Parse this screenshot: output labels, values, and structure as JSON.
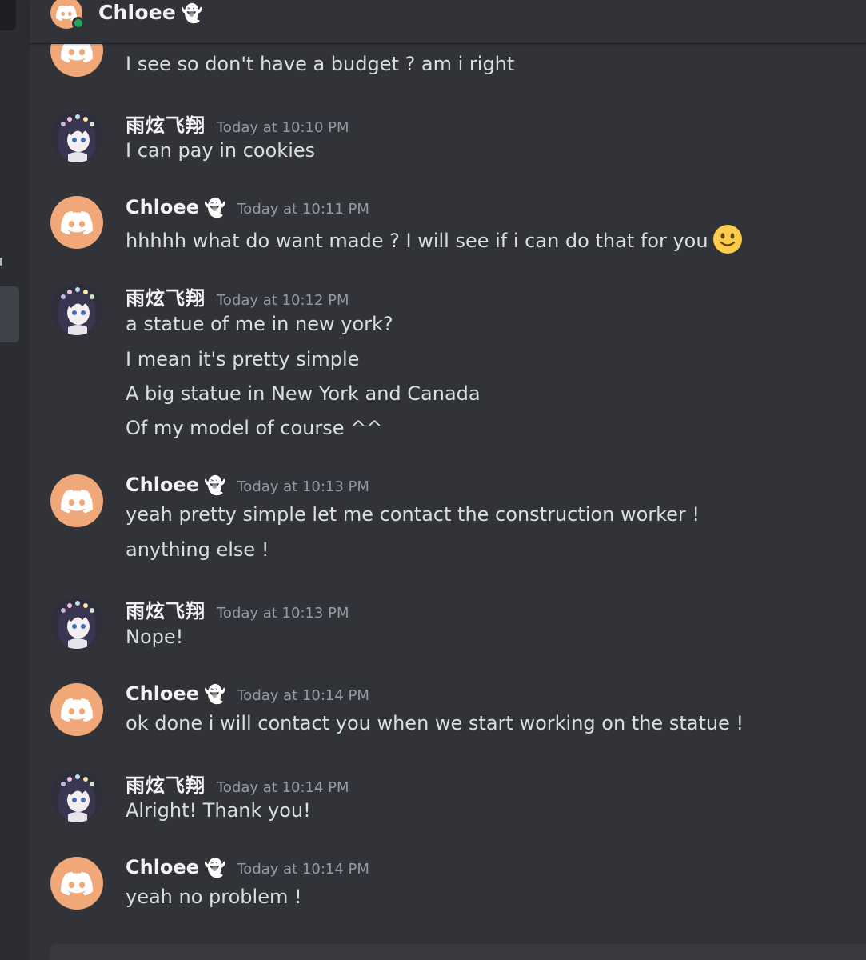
{
  "header": {
    "title": "Chloee"
  },
  "colors": {
    "online": "#23a55a",
    "discord_avatar": "#f0a878",
    "background": "#313338"
  },
  "messages": [
    {
      "author": "Chloee",
      "cjk": false,
      "avatar": "discord-avatar",
      "timestamp": "",
      "lines": [
        "I see so don't have a budget ? am i right"
      ]
    },
    {
      "author": "雨炫飞翔",
      "cjk": true,
      "avatar": "anime-avatar",
      "timestamp": "Today at 10:10 PM",
      "lines": [
        "I can pay in cookies"
      ]
    },
    {
      "author": "Chloee",
      "cjk": false,
      "avatar": "discord-avatar",
      "timestamp": "Today at 10:11 PM",
      "lines": [
        "hhhhh what do want made ? I will see if i can do that for you"
      ],
      "emoji": "slightly-smiling-face"
    },
    {
      "author": "雨炫飞翔",
      "cjk": true,
      "avatar": "anime-avatar",
      "timestamp": "Today at 10:12 PM",
      "lines": [
        "a statue of me in new york?",
        "I mean it's pretty simple",
        "A big statue in New York and Canada",
        "Of my model of course ^^"
      ]
    },
    {
      "author": "Chloee",
      "cjk": false,
      "avatar": "discord-avatar",
      "timestamp": "Today at 10:13 PM",
      "lines": [
        "yeah pretty simple let me contact the construction worker !",
        "anything else !"
      ]
    },
    {
      "author": "雨炫飞翔",
      "cjk": true,
      "avatar": "anime-avatar",
      "timestamp": "Today at 10:13 PM",
      "lines": [
        "Nope!"
      ]
    },
    {
      "author": "Chloee",
      "cjk": false,
      "avatar": "discord-avatar",
      "timestamp": "Today at 10:14 PM",
      "lines": [
        "ok done i will contact you when we start working on the statue !"
      ]
    },
    {
      "author": "雨炫飞翔",
      "cjk": true,
      "avatar": "anime-avatar",
      "timestamp": "Today at 10:14 PM",
      "lines": [
        "Alright! Thank you!"
      ]
    },
    {
      "author": "Chloee",
      "cjk": false,
      "avatar": "discord-avatar",
      "timestamp": "Today at 10:14 PM",
      "lines": [
        "yeah no problem !"
      ]
    }
  ]
}
